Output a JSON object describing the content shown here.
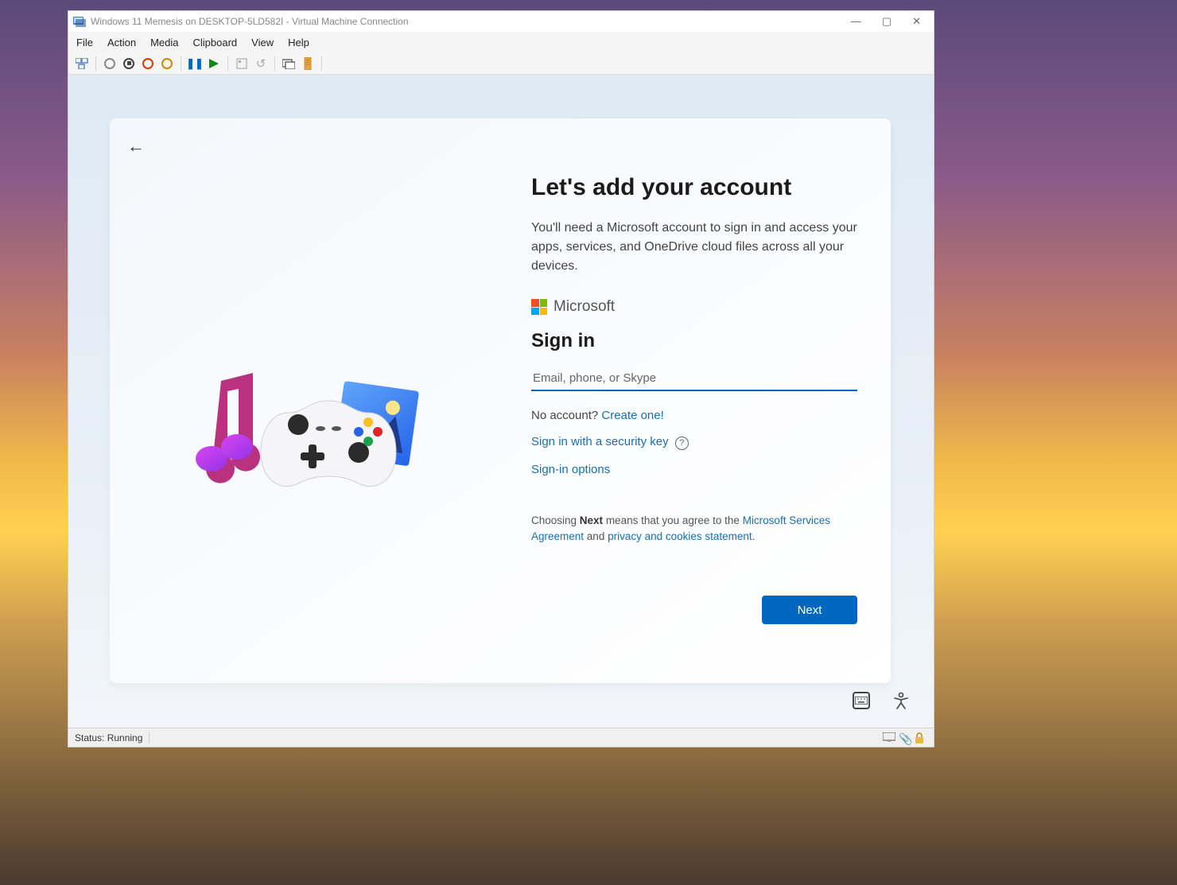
{
  "window": {
    "title": "Windows 11 Memesis on DESKTOP-5LD582I - Virtual Machine Connection"
  },
  "win_controls": {
    "minimize": "—",
    "maximize": "▢",
    "close": "✕"
  },
  "menu": {
    "file": "File",
    "action": "Action",
    "media": "Media",
    "clipboard": "Clipboard",
    "view": "View",
    "help": "Help"
  },
  "oobe": {
    "heading": "Let's add your account",
    "subtext": "You'll need a Microsoft account to sign in and access your apps, services, and OneDrive cloud files across all your devices.",
    "ms_label": "Microsoft",
    "signin": "Sign in",
    "email_placeholder": "Email, phone, or Skype",
    "no_account": "No account? ",
    "create_one": "Create one!",
    "security_key": "Sign in with a security key",
    "signin_options": "Sign-in options",
    "agree_pre": "Choosing ",
    "agree_bold": "Next",
    "agree_mid": " means that you agree to the ",
    "agree_link1": "Microsoft Services Agreement",
    "agree_and": " and ",
    "agree_link2": "privacy and cookies statement",
    "agree_end": ".",
    "next": "Next"
  },
  "status": {
    "text": "Status: Running"
  }
}
